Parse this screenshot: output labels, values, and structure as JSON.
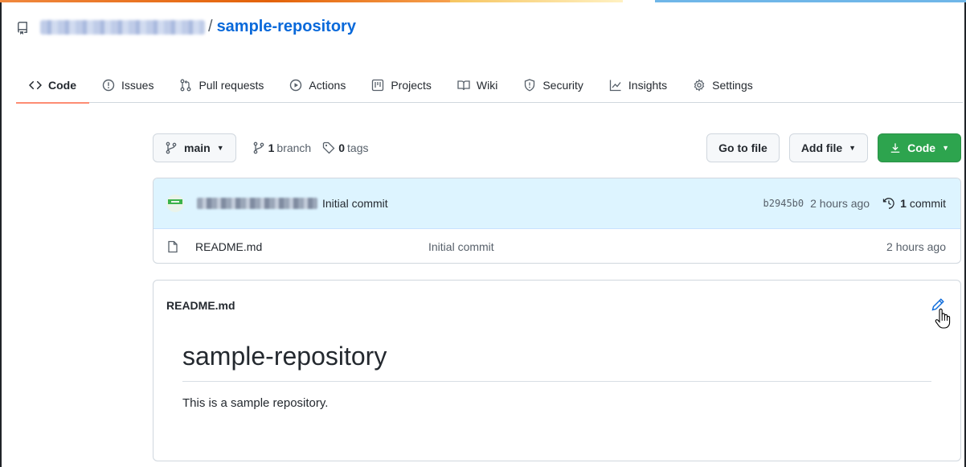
{
  "header": {
    "separator": "/",
    "repo_name": "sample-repository"
  },
  "tabs": [
    {
      "label": "Code",
      "icon": "code-icon",
      "active": true
    },
    {
      "label": "Issues",
      "icon": "issue-icon"
    },
    {
      "label": "Pull requests",
      "icon": "pull-request-icon"
    },
    {
      "label": "Actions",
      "icon": "play-icon"
    },
    {
      "label": "Projects",
      "icon": "project-icon"
    },
    {
      "label": "Wiki",
      "icon": "book-icon"
    },
    {
      "label": "Security",
      "icon": "shield-icon"
    },
    {
      "label": "Insights",
      "icon": "graph-icon"
    },
    {
      "label": "Settings",
      "icon": "gear-icon"
    }
  ],
  "branchbar": {
    "branch": "main",
    "branch_count": "1",
    "branch_word": "branch",
    "tag_count": "0",
    "tag_word": "tags",
    "go_to_file": "Go to file",
    "add_file": "Add file",
    "code": "Code"
  },
  "commit": {
    "message": "Initial commit",
    "sha": "b2945b0",
    "ago": "2 hours ago",
    "count": "1",
    "count_word": "commit"
  },
  "files": [
    {
      "name": "README.md",
      "message": "Initial commit",
      "ago": "2 hours ago"
    }
  ],
  "readme": {
    "filename": "README.md",
    "title": "sample-repository",
    "text": "This is a sample repository."
  },
  "colors": {
    "accent": "#0969da",
    "green_button": "#2da44e",
    "active_tab_underline": "#fd8c73",
    "commit_row_bg": "#ddf4ff"
  }
}
